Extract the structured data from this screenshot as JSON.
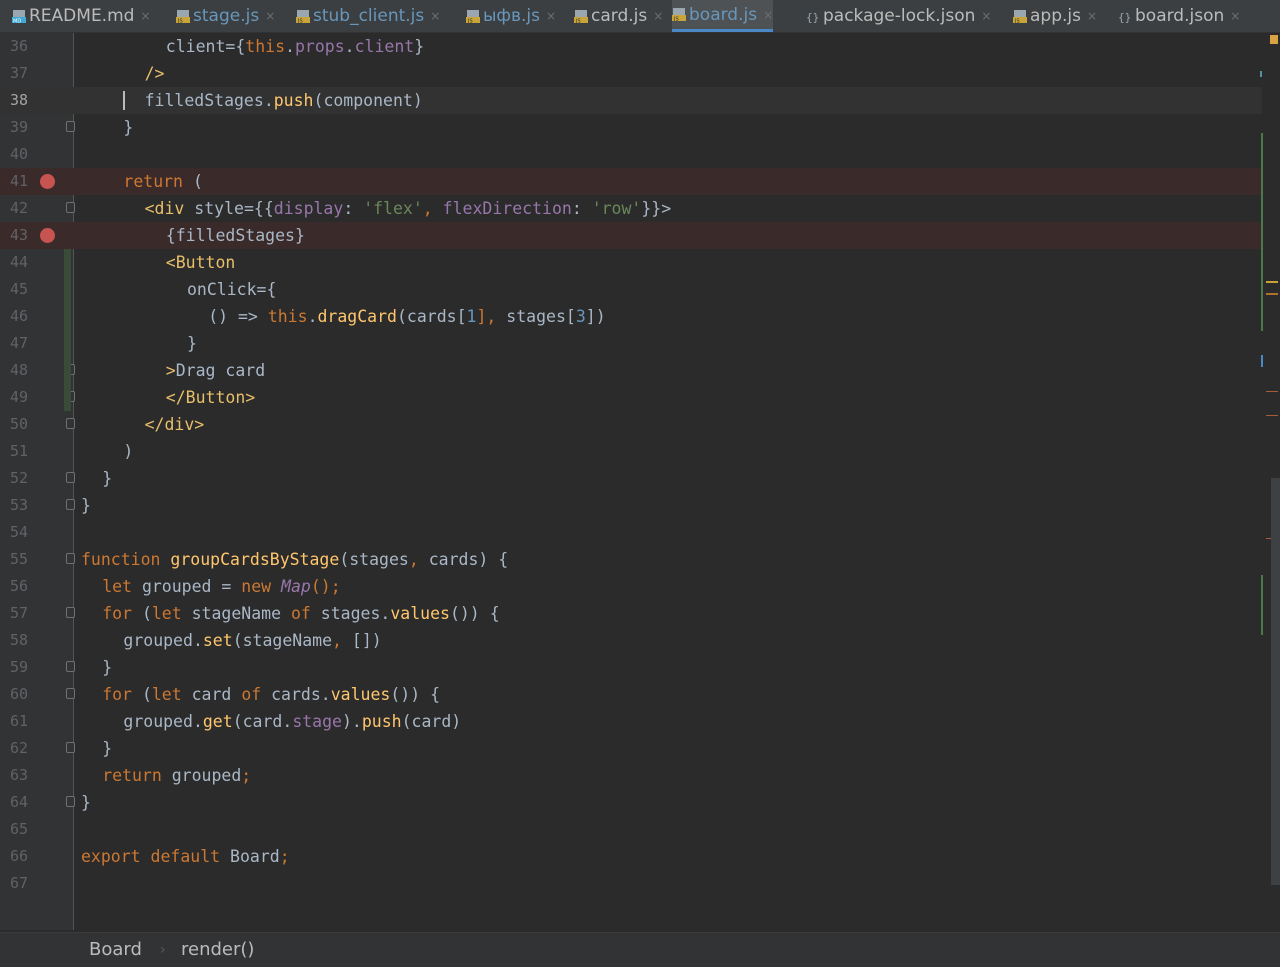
{
  "tabs": [
    {
      "label": "README.md",
      "kind": "md"
    },
    {
      "label": "stage.js",
      "kind": "js"
    },
    {
      "label": "stub_client.js",
      "kind": "js"
    },
    {
      "label": "ыфв.js",
      "kind": "js"
    },
    {
      "label": "card.js",
      "kind": "js-plain"
    },
    {
      "label": "board.js",
      "kind": "js",
      "active": true
    },
    {
      "label": "package-lock.json",
      "kind": "json"
    },
    {
      "label": "app.js",
      "kind": "js-plain"
    },
    {
      "label": "board.json",
      "kind": "json"
    }
  ],
  "close_glyph": "×",
  "editor": {
    "current_line": "38",
    "breakpoint_lines": [
      "41",
      "43"
    ],
    "lines": [
      {
        "n": "36",
        "text": "client={this.props.client}"
      },
      {
        "n": "37",
        "text": "/>"
      },
      {
        "n": "38",
        "text": "filledStages.push(component)"
      },
      {
        "n": "39",
        "text": "}"
      },
      {
        "n": "40",
        "text": ""
      },
      {
        "n": "41",
        "text": "return ("
      },
      {
        "n": "42",
        "text": "<div style={{display: 'flex', flexDirection: 'row'}}>"
      },
      {
        "n": "43",
        "text": "{filledStages}"
      },
      {
        "n": "44",
        "text": "<Button"
      },
      {
        "n": "45",
        "text": "onClick={"
      },
      {
        "n": "46",
        "text": "() => this.dragCard(cards[1], stages[3])"
      },
      {
        "n": "47",
        "text": "}"
      },
      {
        "n": "48",
        "text": ">Drag card"
      },
      {
        "n": "49",
        "text": "</Button>"
      },
      {
        "n": "50",
        "text": "</div>"
      },
      {
        "n": "51",
        "text": ")"
      },
      {
        "n": "52",
        "text": "}"
      },
      {
        "n": "53",
        "text": "}"
      },
      {
        "n": "54",
        "text": ""
      },
      {
        "n": "55",
        "text": "function groupCardsByStage(stages, cards) {"
      },
      {
        "n": "56",
        "text": "let grouped = new Map();"
      },
      {
        "n": "57",
        "text": "for (let stageName of stages.values()) {"
      },
      {
        "n": "58",
        "text": "grouped.set(stageName, [])"
      },
      {
        "n": "59",
        "text": "}"
      },
      {
        "n": "60",
        "text": "for (let card of cards.values()) {"
      },
      {
        "n": "61",
        "text": "grouped.get(card.stage).push(card)"
      },
      {
        "n": "62",
        "text": "}"
      },
      {
        "n": "63",
        "text": "return grouped;"
      },
      {
        "n": "64",
        "text": "}"
      },
      {
        "n": "65",
        "text": ""
      },
      {
        "n": "66",
        "text": "export default Board;"
      },
      {
        "n": "67",
        "text": ""
      }
    ]
  },
  "breadcrumb": {
    "items": [
      "Board",
      "render()"
    ],
    "separator": "›"
  },
  "colors": {
    "background": "#2b2b2b",
    "keyword": "#cc7832",
    "function": "#ffc66d",
    "string": "#6a8759",
    "number": "#6897bb",
    "tag": "#e8bf6a",
    "property": "#9876aa",
    "breakpoint": "#c75450",
    "active_tab_underline": "#4a88c7"
  }
}
